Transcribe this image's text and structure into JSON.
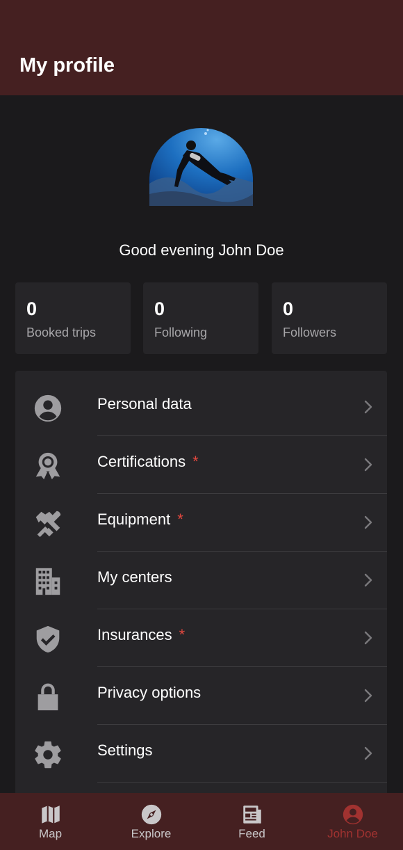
{
  "header": {
    "title": "My profile"
  },
  "profile": {
    "greeting": "Good evening John Doe"
  },
  "stats": [
    {
      "value": "0",
      "label": "Booked trips"
    },
    {
      "value": "0",
      "label": "Following"
    },
    {
      "value": "0",
      "label": "Followers"
    }
  ],
  "menu": [
    {
      "label": "Personal data",
      "icon": "person-icon",
      "required": false
    },
    {
      "label": "Certifications",
      "icon": "award-icon",
      "required": true,
      "marker": "*"
    },
    {
      "label": "Equipment",
      "icon": "tools-icon",
      "required": true,
      "marker": "*"
    },
    {
      "label": "My centers",
      "icon": "building-icon",
      "required": false
    },
    {
      "label": "Insurances",
      "icon": "shield-check-icon",
      "required": true,
      "marker": "*"
    },
    {
      "label": "Privacy options",
      "icon": "lock-icon",
      "required": false
    },
    {
      "label": "Settings",
      "icon": "gear-icon",
      "required": false
    }
  ],
  "nav": [
    {
      "label": "Map",
      "icon": "map-icon",
      "active": false
    },
    {
      "label": "Explore",
      "icon": "compass-icon",
      "active": false
    },
    {
      "label": "Feed",
      "icon": "newspaper-icon",
      "active": false
    },
    {
      "label": "John Doe",
      "icon": "account-icon",
      "active": true
    }
  ],
  "colors": {
    "header_bg": "#452021",
    "page_bg": "#1b1a1c",
    "card_bg": "#262528",
    "required_marker": "#e5483f",
    "active_nav": "#a13230",
    "icon_gray": "#9e9da0"
  }
}
